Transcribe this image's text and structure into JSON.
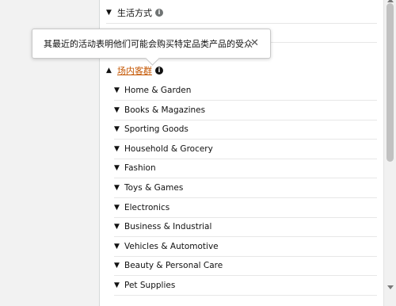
{
  "sections": {
    "lifestyle": {
      "label": "生活方式"
    },
    "in_market": {
      "label": "场内客群"
    }
  },
  "tooltip": {
    "text": "其最近的活动表明他们可能会购买特定品类产品的受众",
    "close": "✕"
  },
  "in_market_items": [
    {
      "label": "Home & Garden"
    },
    {
      "label": "Books & Magazines"
    },
    {
      "label": "Sporting Goods"
    },
    {
      "label": "Household & Grocery"
    },
    {
      "label": "Fashion"
    },
    {
      "label": "Toys & Games"
    },
    {
      "label": "Electronics"
    },
    {
      "label": "Business & Industrial"
    },
    {
      "label": "Vehicles & Automotive"
    },
    {
      "label": "Beauty & Personal Care"
    },
    {
      "label": "Pet Supplies"
    }
  ],
  "icons": {
    "caret_down": "chevron-down-icon",
    "caret_up": "chevron-up-icon",
    "info": "info-icon",
    "close": "close-icon"
  },
  "colors": {
    "link": "#c45500",
    "text": "#111111",
    "divider": "#e7e7e7"
  }
}
